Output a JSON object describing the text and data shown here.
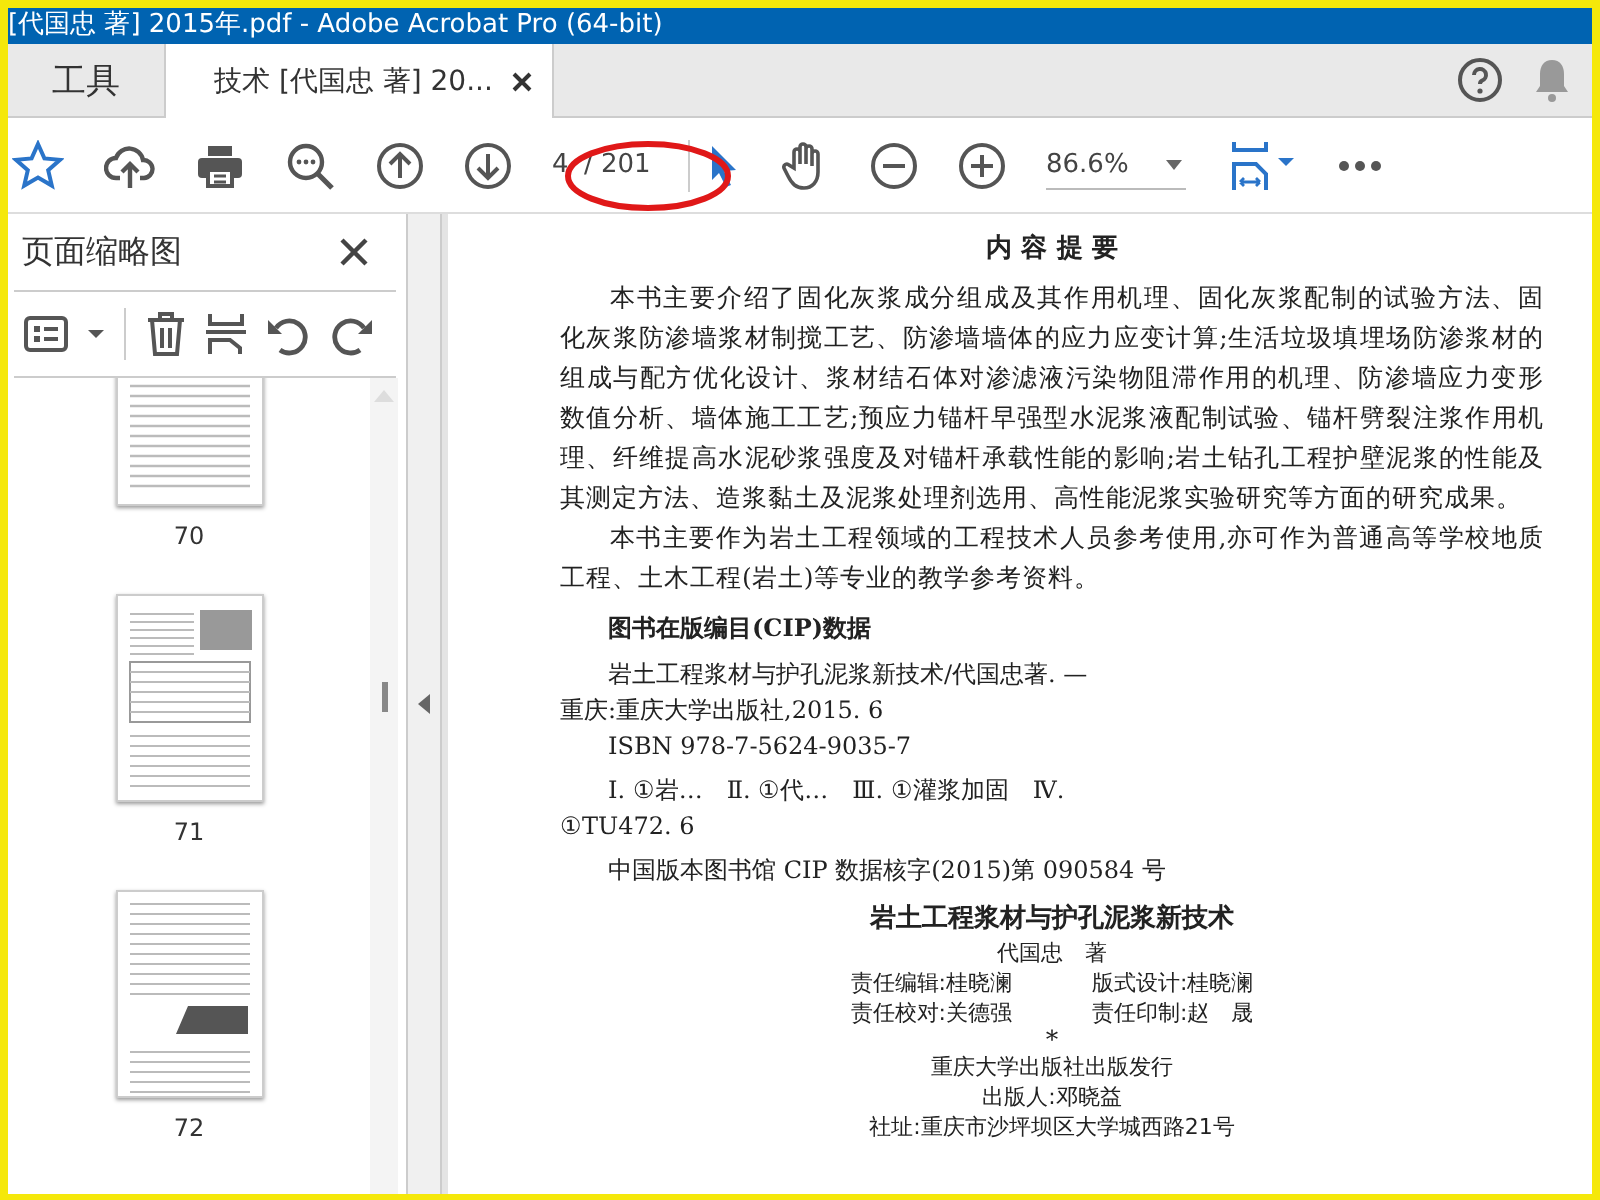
{
  "window": {
    "title": "[代国忠 著] 2015年.pdf - Adobe Acrobat Pro (64-bit)"
  },
  "tabs": [
    {
      "label": "工具",
      "selected": false,
      "closable": false
    },
    {
      "label": "技术 [代国忠 著] 20...",
      "selected": true,
      "closable": true
    }
  ],
  "toolbar": {
    "page_number": "4",
    "page_total": "/ 201",
    "zoom": "86.6%"
  },
  "sidebar": {
    "title": "页面缩略图",
    "thumbnails": [
      {
        "label": "70",
        "kind": "text"
      },
      {
        "label": "71",
        "kind": "table"
      },
      {
        "label": "72",
        "kind": "figure"
      }
    ]
  },
  "document": {
    "heading": "内 容 提 要",
    "paragraphs": [
      "本书主要介绍了固化灰浆成分组成及其作用机理、固化灰浆配制的试验方法、固化灰浆防渗墙浆材制搅工艺、防渗墙墙体的应力应变计算;生活垃圾填埋场防渗浆材的组成与配方优化设计、浆材结石体对渗滤液污染物阻滞作用的机理、防渗墙应力变形数值分析、墙体施工工艺;预应力锚杆早强型水泥浆液配制试验、锚杆劈裂注浆作用机理、纤维提高水泥砂浆强度及对锚杆承载性能的影响;岩土钻孔工程护壁泥浆的性能及其测定方法、造浆黏土及泥浆处理剂选用、高性能泥浆实验研究等方面的研究成果。",
      "本书主要作为岩土工程领域的工程技术人员参考使用,亦可作为普通高等学校地质工程、土木工程(岩土)等专业的教学参考资料。"
    ],
    "cip_heading": "图书在版编目(CIP)数据",
    "cip_groups": [
      [
        {
          "text": "岩土工程浆材与护孔泥浆新技术/代国忠著. —",
          "indented": true
        },
        {
          "text": "重庆:重庆大学出版社,2015. 6",
          "indented": false
        },
        {
          "text": "ISBN 978-7-5624-9035-7",
          "indented": true
        }
      ],
      [
        {
          "text": "Ⅰ. ①岩…　Ⅱ. ①代…　Ⅲ. ①灌浆加固　Ⅳ.",
          "indented": true
        },
        {
          "text": "①TU472. 6",
          "indented": false
        }
      ],
      [
        {
          "text": "中国版本图书馆 CIP 数据核字(2015)第 090584 号",
          "indented": true
        }
      ]
    ],
    "book_title": "岩土工程浆材与护孔泥浆新技术",
    "author": "代国忠　著",
    "credits": [
      [
        "责任编辑:桂晓澜",
        "版式设计:桂晓澜"
      ],
      [
        "责任校对:关德强",
        "责任印制:赵　晟"
      ]
    ],
    "separator": "*",
    "publisher_lines": [
      "重庆大学出版社出版发行",
      "出版人:邓晓益",
      "社址:重庆市沙坪坝区大学城西路21号"
    ]
  }
}
